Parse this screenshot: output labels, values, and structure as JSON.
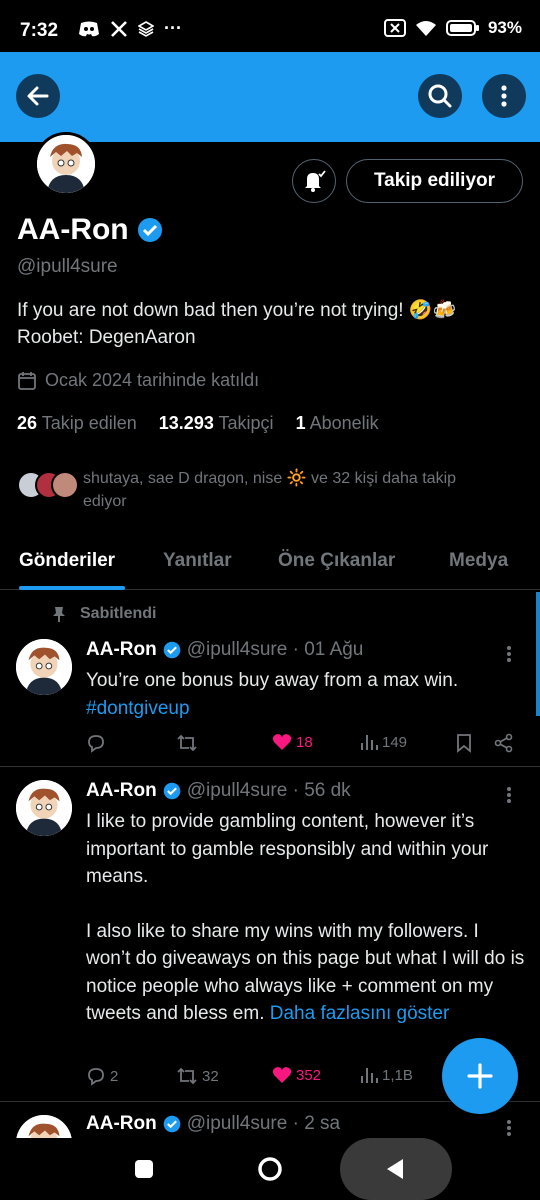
{
  "status_bar": {
    "time": "7:32",
    "battery": "93%",
    "more": "···"
  },
  "profile": {
    "name": "AA-Ron",
    "handle": "@ipull4sure",
    "bio_line1": "If you are not down bad then you’re not trying! 🤣🍻",
    "bio_line2": "Roobet: DegenAaron",
    "joined": "Ocak 2024 tarihinde katıldı",
    "follow_button": "Takip ediliyor",
    "following_count": "26",
    "following_label": "Takip edilen",
    "followers_count": "13.293",
    "followers_label": "Takipçi",
    "subs_count": "1",
    "subs_label": "Abonelik",
    "known_followers_line1": "shutaya, sae D dragon, nise 🔆 ve 32 kişi daha takip",
    "known_followers_line2": "ediyor"
  },
  "tabs": [
    "Gönderiler",
    "Yanıtlar",
    "Öne Çıkanlar",
    "Medya"
  ],
  "tweets": [
    {
      "pinned_label": "Sabitlendi",
      "name": "AA-Ron",
      "handle_time": "@ipull4sure · 01 Ağu",
      "text": "You’re one bonus buy away from a max win.",
      "hashtag": "#dontgiveup",
      "replies": "",
      "retweets": "",
      "likes": "18",
      "views": "149"
    },
    {
      "name": "AA-Ron",
      "handle_time": "@ipull4sure · 56 dk",
      "para1": "I like to provide gambling content, however it’s important to gamble responsibly and within your means.",
      "para2": "I also like to share my wins with my followers. I won’t do giveaways on this page but what I will do is notice people who always like + comment on my tweets and bless em.",
      "show_more": "Daha fazlasını göster",
      "replies": "2",
      "retweets": "32",
      "likes": "352",
      "views": "1,1B"
    },
    {
      "name": "AA-Ron",
      "handle_time": "@ipull4sure · 2 sa"
    }
  ],
  "colors": {
    "accent": "#1d9bf0",
    "like": "#f91880",
    "muted": "#71767b"
  }
}
